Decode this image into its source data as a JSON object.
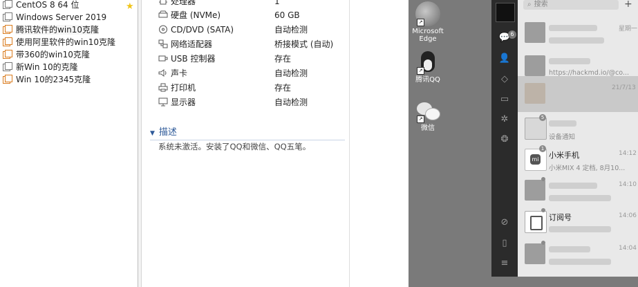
{
  "vm_list": {
    "items": [
      {
        "label": "CentOS 8 64 位",
        "icon": "vm-icon",
        "favorite": true
      },
      {
        "label": "Windows Server 2019",
        "icon": "vm-icon"
      },
      {
        "label": "腾讯软件的win10克隆",
        "icon": "clone-vm-icon"
      },
      {
        "label": "使用阿里软件的win10克隆",
        "icon": "clone-vm-icon"
      },
      {
        "label": "带360的win10克隆",
        "icon": "clone-vm-icon"
      },
      {
        "label": "新Win 10的克隆",
        "icon": "vm-icon"
      },
      {
        "label": "Win 10的2345克隆",
        "icon": "clone-vm-icon"
      }
    ]
  },
  "hardware": {
    "rows": [
      {
        "name": "处理器",
        "value": "1",
        "icon": "cpu-icon"
      },
      {
        "name": "硬盘 (NVMe)",
        "value": "60 GB",
        "icon": "hard-disk-icon"
      },
      {
        "name": "CD/DVD (SATA)",
        "value": "自动检测",
        "icon": "cd-dvd-icon"
      },
      {
        "name": "网络适配器",
        "value": "桥接模式 (自动)",
        "icon": "network-adapter-icon"
      },
      {
        "name": "USB 控制器",
        "value": "存在",
        "icon": "usb-icon"
      },
      {
        "name": "声卡",
        "value": "自动检测",
        "icon": "sound-card-icon"
      },
      {
        "name": "打印机",
        "value": "存在",
        "icon": "printer-icon"
      },
      {
        "name": "显示器",
        "value": "自动检测",
        "icon": "display-icon"
      }
    ]
  },
  "description": {
    "header": "描述",
    "text": "系统未激活。安装了QQ和微信、QQ五笔。"
  },
  "desktop": {
    "icons": [
      {
        "label": "Microsoft Edge",
        "icon": "edge-icon"
      },
      {
        "label": "腾讯QQ",
        "icon": "qq-icon"
      },
      {
        "label": "微信",
        "icon": "wechat-icon"
      }
    ]
  },
  "wechat": {
    "unread_badge": "6",
    "search_placeholder": "搜索",
    "side_icons": [
      "chat-icon",
      "contacts-icon",
      "favorites-icon",
      "files-icon",
      "moments-icon",
      "channels-icon",
      "miniprogram-icon",
      "phone-icon",
      "menu-icon"
    ],
    "chats": [
      {
        "name": "",
        "preview": "",
        "time": "星期一",
        "badge": ""
      },
      {
        "name": "",
        "preview": "https://hackmd.io/@co...",
        "time": "",
        "badge": ""
      },
      {
        "name": "",
        "preview": "",
        "time": "21/7/13",
        "badge": ""
      },
      {
        "name": "",
        "preview": "设备通知",
        "time": "",
        "badge": "5"
      },
      {
        "name": "小米手机",
        "preview": "小米MIX 4 定档, 8月10...",
        "time": "14:12",
        "badge": "1"
      },
      {
        "name": "",
        "preview": "",
        "time": "14:10",
        "badge": ""
      },
      {
        "name": "订阅号",
        "preview": "",
        "time": "14:06",
        "badge": ""
      },
      {
        "name": "",
        "preview": "",
        "time": "14:04",
        "badge": ""
      }
    ]
  }
}
